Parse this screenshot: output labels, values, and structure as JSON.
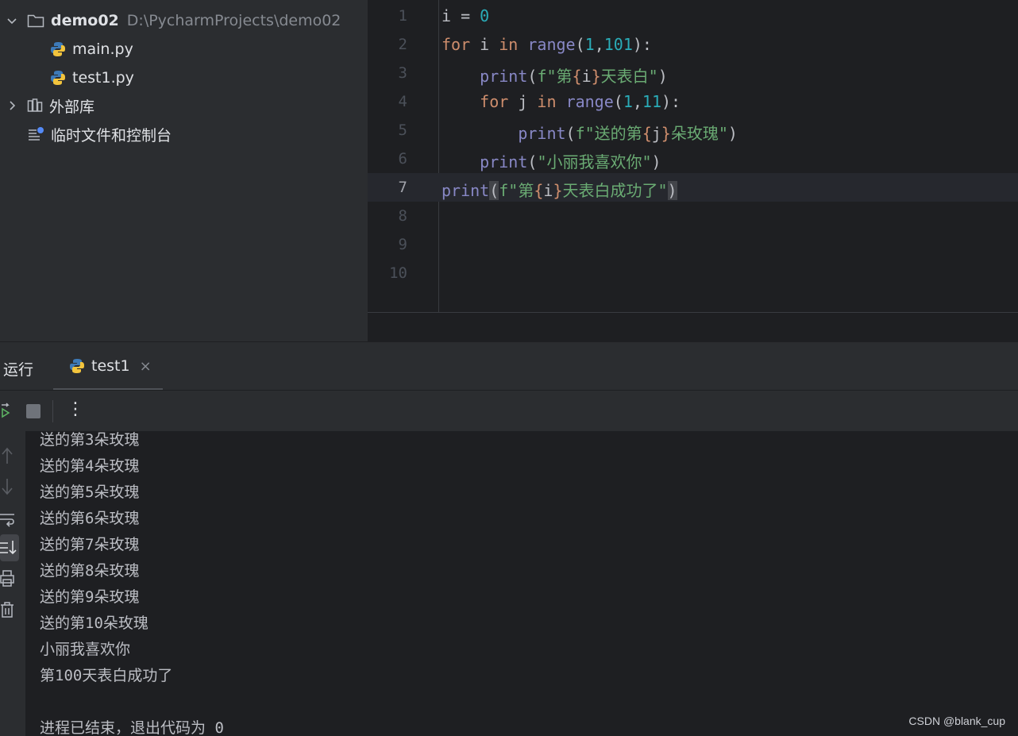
{
  "project_tree": {
    "root_name": "demo02",
    "root_path": "D:\\PycharmProjects\\demo02",
    "files": [
      "main.py",
      "test1.py"
    ],
    "external_libraries": "外部库",
    "scratches": "临时文件和控制台"
  },
  "editor": {
    "line_numbers": [
      "1",
      "2",
      "3",
      "4",
      "5",
      "6",
      "7",
      "8",
      "9",
      "10"
    ],
    "current_line": 7
  },
  "run_panel": {
    "title": "运行",
    "tab_label": "test1",
    "tab_close": "×",
    "more_glyph": "⋮",
    "output_lines": [
      "送的第3朵玫瑰",
      "送的第4朵玫瑰",
      "送的第5朵玫瑰",
      "送的第6朵玫瑰",
      "送的第7朵玫瑰",
      "送的第8朵玫瑰",
      "送的第9朵玫瑰",
      "送的第10朵玫瑰",
      "小丽我喜欢你",
      "第100天表白成功了",
      "",
      "进程已结束，退出代码为 0"
    ]
  },
  "watermark": "CSDN @blank_cup",
  "colors": {
    "keyword": "#cf8e6d",
    "builtin": "#8888c6",
    "number": "#2aacb8",
    "string": "#6aab73",
    "editor_bg": "#1e1f22",
    "panel_bg": "#2b2d30"
  }
}
